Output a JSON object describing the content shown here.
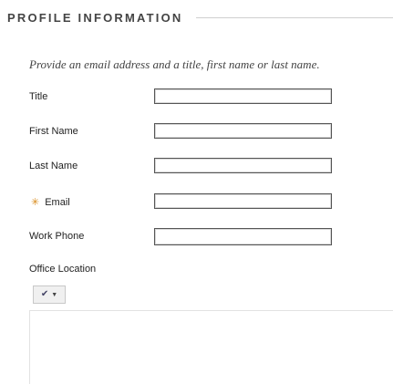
{
  "section": {
    "title": "PROFILE INFORMATION"
  },
  "instructions": "Provide an email address and a title, first name or last name.",
  "fields": [
    {
      "label": "Title",
      "value": "",
      "required": false
    },
    {
      "label": "First Name",
      "value": "",
      "required": false
    },
    {
      "label": "Last Name",
      "value": "",
      "required": false
    },
    {
      "label": "Email",
      "value": "",
      "required": true,
      "required_icon": "asterisk-icon"
    },
    {
      "label": "Work Phone",
      "value": "",
      "required": false
    }
  ],
  "office_location": {
    "label": "Office Location",
    "toolbar": {
      "spellcheck_icon": "spellcheck-icon",
      "dropdown_icon": "chevron-down-icon"
    },
    "value": ""
  },
  "colors": {
    "required_marker": "#d88a1a",
    "section_title": "#444444",
    "rule": "#d0d0d0"
  }
}
